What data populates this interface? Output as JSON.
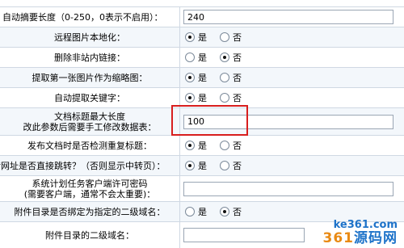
{
  "rows": [
    {
      "label_lines": [
        "自动摘要长度（0-250，0表示不启用）："
      ],
      "field": "text",
      "value": "240"
    },
    {
      "label_lines": [
        "远程图片本地化："
      ],
      "field": "radio",
      "selected": "yes"
    },
    {
      "label_lines": [
        "删除非站内链接："
      ],
      "field": "radio",
      "selected": "no"
    },
    {
      "label_lines": [
        "提取第一张图片作为缩略图："
      ],
      "field": "radio",
      "selected": "yes"
    },
    {
      "label_lines": [
        "自动提取关键字："
      ],
      "field": "radio",
      "selected": "yes"
    },
    {
      "label_lines": [
        "文档标题最大长度",
        "改此参数后需要手工修改数据表："
      ],
      "field": "text",
      "value": "100"
    },
    {
      "label_lines": [
        "发布文档时是否检测重复标题："
      ],
      "field": "radio",
      "selected": "yes"
    },
    {
      "label_lines": [
        "转网址是否直接跳转？（否则显示中转页）："
      ],
      "field": "radio",
      "selected": "yes"
    },
    {
      "label_lines": [
        "系统计划任务客户端许可密码",
        "(需要客户端，通常不会太重要)："
      ],
      "field": "text",
      "value": ""
    },
    {
      "label_lines": [
        "附件目录是否绑定为指定的二级域名："
      ],
      "field": "radio",
      "selected": "no"
    },
    {
      "label_lines": [
        "附件目录的二级域名："
      ],
      "field": "text",
      "value": ""
    }
  ],
  "radio_labels": {
    "yes": "是",
    "no": "否"
  },
  "watermark": {
    "line1": "ke361.com",
    "line2_num": "361",
    "line2_text": "源码网"
  },
  "colors": {
    "highlight": "#d81e1e",
    "border": "#cfd8e3",
    "alt_row": "#f3f7fb"
  }
}
